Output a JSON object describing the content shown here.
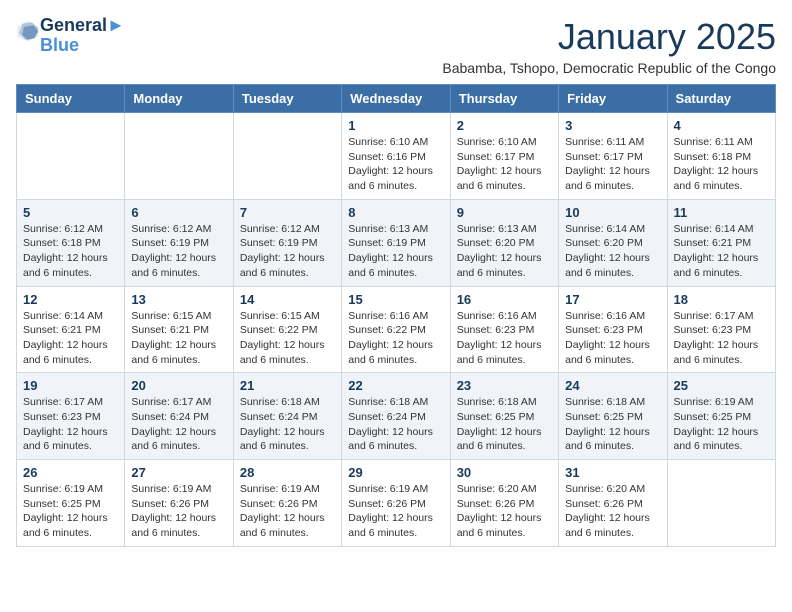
{
  "logo": {
    "line1": "General",
    "line2": "Blue"
  },
  "title": "January 2025",
  "subtitle": "Babamba, Tshopo, Democratic Republic of the Congo",
  "days_of_week": [
    "Sunday",
    "Monday",
    "Tuesday",
    "Wednesday",
    "Thursday",
    "Friday",
    "Saturday"
  ],
  "weeks": [
    [
      {
        "day": "",
        "info": ""
      },
      {
        "day": "",
        "info": ""
      },
      {
        "day": "",
        "info": ""
      },
      {
        "day": "1",
        "info": "Sunrise: 6:10 AM\nSunset: 6:16 PM\nDaylight: 12 hours and 6 minutes."
      },
      {
        "day": "2",
        "info": "Sunrise: 6:10 AM\nSunset: 6:17 PM\nDaylight: 12 hours and 6 minutes."
      },
      {
        "day": "3",
        "info": "Sunrise: 6:11 AM\nSunset: 6:17 PM\nDaylight: 12 hours and 6 minutes."
      },
      {
        "day": "4",
        "info": "Sunrise: 6:11 AM\nSunset: 6:18 PM\nDaylight: 12 hours and 6 minutes."
      }
    ],
    [
      {
        "day": "5",
        "info": "Sunrise: 6:12 AM\nSunset: 6:18 PM\nDaylight: 12 hours and 6 minutes."
      },
      {
        "day": "6",
        "info": "Sunrise: 6:12 AM\nSunset: 6:19 PM\nDaylight: 12 hours and 6 minutes."
      },
      {
        "day": "7",
        "info": "Sunrise: 6:12 AM\nSunset: 6:19 PM\nDaylight: 12 hours and 6 minutes."
      },
      {
        "day": "8",
        "info": "Sunrise: 6:13 AM\nSunset: 6:19 PM\nDaylight: 12 hours and 6 minutes."
      },
      {
        "day": "9",
        "info": "Sunrise: 6:13 AM\nSunset: 6:20 PM\nDaylight: 12 hours and 6 minutes."
      },
      {
        "day": "10",
        "info": "Sunrise: 6:14 AM\nSunset: 6:20 PM\nDaylight: 12 hours and 6 minutes."
      },
      {
        "day": "11",
        "info": "Sunrise: 6:14 AM\nSunset: 6:21 PM\nDaylight: 12 hours and 6 minutes."
      }
    ],
    [
      {
        "day": "12",
        "info": "Sunrise: 6:14 AM\nSunset: 6:21 PM\nDaylight: 12 hours and 6 minutes."
      },
      {
        "day": "13",
        "info": "Sunrise: 6:15 AM\nSunset: 6:21 PM\nDaylight: 12 hours and 6 minutes."
      },
      {
        "day": "14",
        "info": "Sunrise: 6:15 AM\nSunset: 6:22 PM\nDaylight: 12 hours and 6 minutes."
      },
      {
        "day": "15",
        "info": "Sunrise: 6:16 AM\nSunset: 6:22 PM\nDaylight: 12 hours and 6 minutes."
      },
      {
        "day": "16",
        "info": "Sunrise: 6:16 AM\nSunset: 6:23 PM\nDaylight: 12 hours and 6 minutes."
      },
      {
        "day": "17",
        "info": "Sunrise: 6:16 AM\nSunset: 6:23 PM\nDaylight: 12 hours and 6 minutes."
      },
      {
        "day": "18",
        "info": "Sunrise: 6:17 AM\nSunset: 6:23 PM\nDaylight: 12 hours and 6 minutes."
      }
    ],
    [
      {
        "day": "19",
        "info": "Sunrise: 6:17 AM\nSunset: 6:23 PM\nDaylight: 12 hours and 6 minutes."
      },
      {
        "day": "20",
        "info": "Sunrise: 6:17 AM\nSunset: 6:24 PM\nDaylight: 12 hours and 6 minutes."
      },
      {
        "day": "21",
        "info": "Sunrise: 6:18 AM\nSunset: 6:24 PM\nDaylight: 12 hours and 6 minutes."
      },
      {
        "day": "22",
        "info": "Sunrise: 6:18 AM\nSunset: 6:24 PM\nDaylight: 12 hours and 6 minutes."
      },
      {
        "day": "23",
        "info": "Sunrise: 6:18 AM\nSunset: 6:25 PM\nDaylight: 12 hours and 6 minutes."
      },
      {
        "day": "24",
        "info": "Sunrise: 6:18 AM\nSunset: 6:25 PM\nDaylight: 12 hours and 6 minutes."
      },
      {
        "day": "25",
        "info": "Sunrise: 6:19 AM\nSunset: 6:25 PM\nDaylight: 12 hours and 6 minutes."
      }
    ],
    [
      {
        "day": "26",
        "info": "Sunrise: 6:19 AM\nSunset: 6:25 PM\nDaylight: 12 hours and 6 minutes."
      },
      {
        "day": "27",
        "info": "Sunrise: 6:19 AM\nSunset: 6:26 PM\nDaylight: 12 hours and 6 minutes."
      },
      {
        "day": "28",
        "info": "Sunrise: 6:19 AM\nSunset: 6:26 PM\nDaylight: 12 hours and 6 minutes."
      },
      {
        "day": "29",
        "info": "Sunrise: 6:19 AM\nSunset: 6:26 PM\nDaylight: 12 hours and 6 minutes."
      },
      {
        "day": "30",
        "info": "Sunrise: 6:20 AM\nSunset: 6:26 PM\nDaylight: 12 hours and 6 minutes."
      },
      {
        "day": "31",
        "info": "Sunrise: 6:20 AM\nSunset: 6:26 PM\nDaylight: 12 hours and 6 minutes."
      },
      {
        "day": "",
        "info": ""
      }
    ]
  ]
}
